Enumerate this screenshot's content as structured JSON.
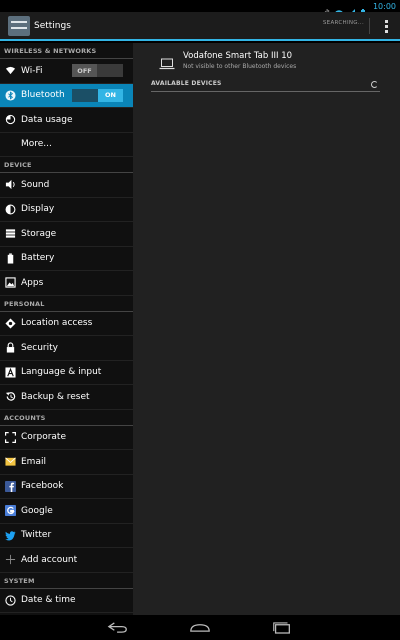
{
  "status_bar": {
    "time": "10:00"
  },
  "action_bar": {
    "title": "Settings",
    "searching": "SEARCHING..."
  },
  "sidebar": {
    "headers": {
      "wireless": "WIRELESS & NETWORKS",
      "device": "DEVICE",
      "personal": "PERSONAL",
      "accounts": "ACCOUNTS",
      "system": "SYSTEM"
    },
    "items": {
      "wifi": "Wi-Fi",
      "bluetooth": "Bluetooth",
      "data_usage": "Data usage",
      "more": "More...",
      "sound": "Sound",
      "display": "Display",
      "storage": "Storage",
      "battery": "Battery",
      "apps": "Apps",
      "location": "Location access",
      "security": "Security",
      "language": "Language & input",
      "backup": "Backup & reset",
      "corporate": "Corporate",
      "email": "Email",
      "facebook": "Facebook",
      "google": "Google",
      "twitter": "Twitter",
      "add_account": "Add account",
      "date_time": "Date & time"
    },
    "toggles": {
      "wifi": "OFF",
      "bluetooth": "ON"
    }
  },
  "content": {
    "device_name": "Vodafone Smart Tab III 10",
    "device_status": "Not visible to other Bluetooth devices",
    "available_header": "AVAILABLE DEVICES"
  },
  "colors": {
    "accent": "#33b5e5",
    "selected": "#0a85b8"
  }
}
